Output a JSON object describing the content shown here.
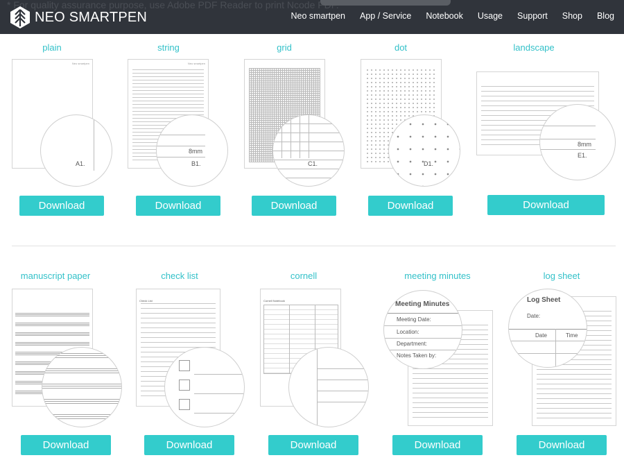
{
  "header": {
    "notice": "* For quality assurance purpose, use Adobe PDF Reader to print Ncode PDF.",
    "brand": "NEO SMARTPEN",
    "nav": [
      "Neo smartpen",
      "App / Service",
      "Notebook",
      "Usage",
      "Support",
      "Shop",
      "Blog"
    ]
  },
  "paper_brand": "Neo smartpen",
  "download_label": "Download",
  "row1": [
    {
      "title": "plain",
      "code": "A1."
    },
    {
      "title": "string",
      "code": "B1.",
      "measure": "8mm"
    },
    {
      "title": "grid",
      "code": "C1."
    },
    {
      "title": "dot",
      "code": "D1."
    },
    {
      "title": "landscape",
      "code": "E1.",
      "measure": "8mm"
    }
  ],
  "row2": [
    {
      "title": "manuscript paper"
    },
    {
      "title": "check list",
      "heading": "Check List"
    },
    {
      "title": "cornell",
      "heading": "Cornell Notebook"
    },
    {
      "title": "meeting minutes",
      "heading": "Meeting Minutes",
      "fields": [
        "Meeting Date:",
        "Location:",
        "Department:",
        "Notes Taken by:"
      ]
    },
    {
      "title": "log sheet",
      "heading": "Log Sheet",
      "date_label": "Date:",
      "columns": [
        "Date",
        "Time"
      ]
    }
  ]
}
